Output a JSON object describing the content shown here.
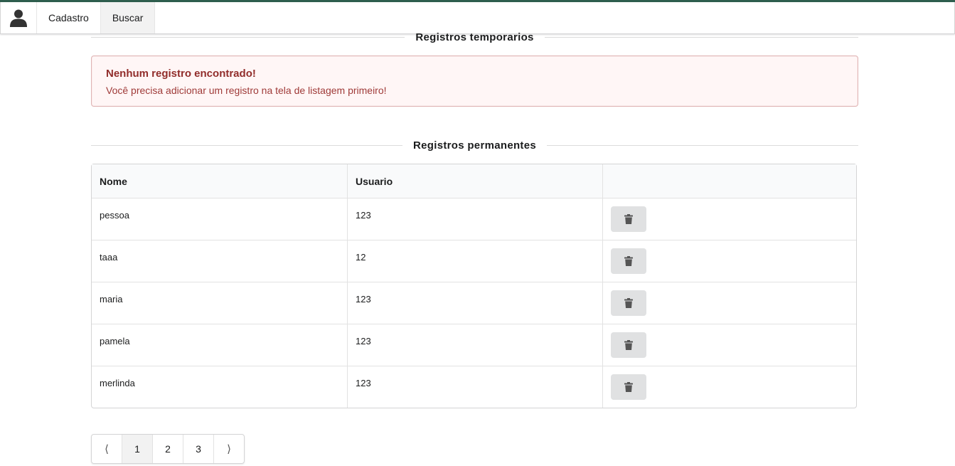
{
  "nav": {
    "items": [
      {
        "label": "Cadastro"
      },
      {
        "label": "Buscar"
      }
    ]
  },
  "sections": {
    "temporary_title": "Registros temporarios",
    "permanent_title": "Registros permanentes"
  },
  "alert": {
    "header": "Nenhum registro encontrado!",
    "message": "Você precisa adicionar um registro na tela de listagem primeiro!"
  },
  "table": {
    "columns": [
      "Nome",
      "Usuario",
      ""
    ],
    "rows": [
      {
        "nome": "pessoa",
        "usuario": "123"
      },
      {
        "nome": "taaa",
        "usuario": "12"
      },
      {
        "nome": "maria",
        "usuario": "123"
      },
      {
        "nome": "pamela",
        "usuario": "123"
      },
      {
        "nome": "merlinda",
        "usuario": "123"
      }
    ]
  },
  "pagination": {
    "prev": "⟨",
    "pages": [
      "1",
      "2",
      "3"
    ],
    "next": "⟩",
    "active_page": "1"
  },
  "colors": {
    "accent_topline": "#2e5e4e",
    "error_text": "#912d2b",
    "error_bg": "#fff6f6"
  }
}
